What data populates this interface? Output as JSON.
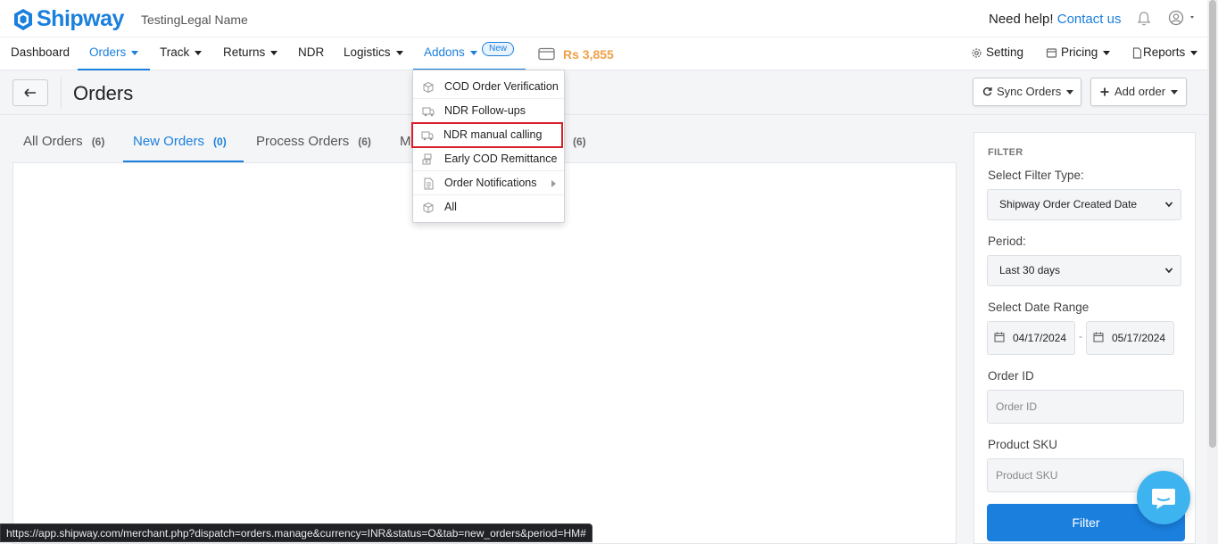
{
  "brand": {
    "name": "Shipway",
    "color": "#1a7fdd"
  },
  "company": "TestingLegal Name",
  "help": {
    "text": "Need help!",
    "link": "Contact us"
  },
  "nav": {
    "dashboard": "Dashboard",
    "orders": "Orders",
    "track": "Track",
    "returns": "Returns",
    "ndr": "NDR",
    "logistics": "Logistics",
    "addons": "Addons",
    "new_badge": "New",
    "balance": "Rs 3,855",
    "setting": "Setting",
    "pricing": "Pricing",
    "reports": "Reports"
  },
  "addons_menu": [
    {
      "label": "COD Order Verification",
      "icon": "shield-box-icon"
    },
    {
      "label": "NDR Follow-ups",
      "icon": "truck-box-icon"
    },
    {
      "label": "NDR manual calling",
      "icon": "truck-box-icon",
      "highlighted": true
    },
    {
      "label": "Early COD Remittance",
      "icon": "money-icon"
    },
    {
      "label": "Order Notifications",
      "icon": "document-icon",
      "submenu": true
    },
    {
      "label": "All",
      "icon": "box-icon"
    }
  ],
  "page": {
    "title": "Orders",
    "sync_button": "Sync Orders",
    "add_button": "Add order"
  },
  "tabs": [
    {
      "label": "All Orders",
      "count": "(6)"
    },
    {
      "label": "New Orders",
      "count": "(0)",
      "active": true
    },
    {
      "label": "Process Orders",
      "count": "(6)"
    },
    {
      "label": "M",
      "count": "(6)"
    }
  ],
  "filter": {
    "heading": "FILTER",
    "type_label": "Select Filter Type:",
    "type_value": "Shipway Order Created Date",
    "period_label": "Period:",
    "period_value": "Last 30 days",
    "range_label": "Select Date Range",
    "date_from": "04/17/2024",
    "date_sep": "-",
    "date_to": "05/17/2024",
    "order_id_label": "Order ID",
    "order_id_placeholder": "Order ID",
    "sku_label": "Product SKU",
    "sku_placeholder": "Product SKU",
    "button": "Filter"
  },
  "status_url": "https://app.shipway.com/merchant.php?dispatch=orders.manage&currency=INR&status=O&tab=new_orders&period=HM#"
}
